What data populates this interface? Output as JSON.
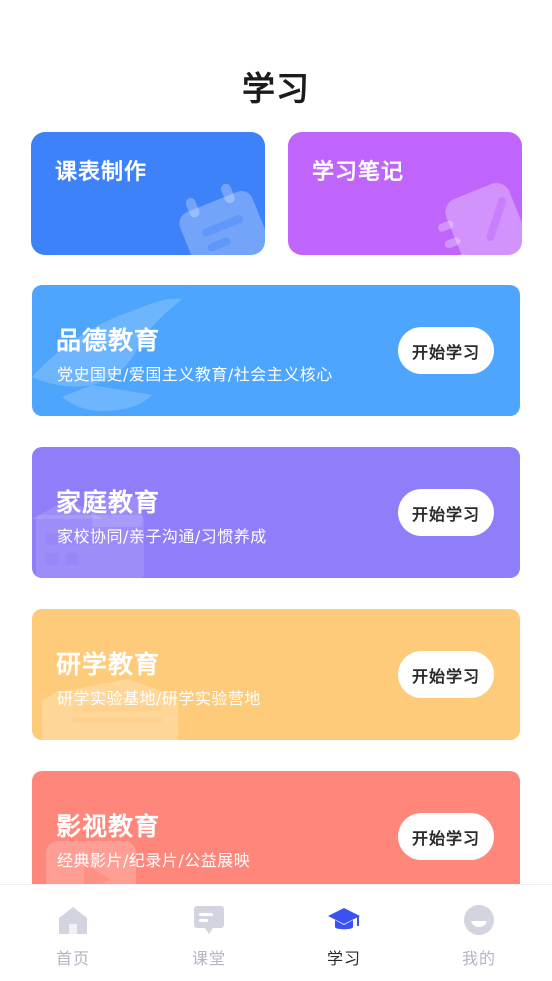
{
  "header": {
    "title": "学习"
  },
  "top_cards": [
    {
      "label": "课表制作",
      "icon": "calendar-icon",
      "color": "#3d82f8"
    },
    {
      "label": "学习笔记",
      "icon": "notebook-icon",
      "color": "#c065fb"
    }
  ],
  "courses": [
    {
      "title": "品德教育",
      "subtitle": "党史国史/爱国主义教育/社会主义核心",
      "button": "开始学习",
      "color": "#4ea5fd",
      "icon": "dove-icon"
    },
    {
      "title": "家庭教育",
      "subtitle": "家校协同/亲子沟通/习惯养成",
      "button": "开始学习",
      "color": "#8f7ef9",
      "icon": "building-icon"
    },
    {
      "title": "研学教育",
      "subtitle": "研学实验基地/研学实验营地",
      "button": "开始学习",
      "color": "#fecb7b",
      "icon": "book-icon"
    },
    {
      "title": "影视教育",
      "subtitle": "经典影片/纪录片/公益展映",
      "button": "开始学习",
      "color": "#fe867a",
      "icon": "play-icon"
    }
  ],
  "tabbar": {
    "items": [
      {
        "label": "首页",
        "icon": "home-icon",
        "active": false
      },
      {
        "label": "课堂",
        "icon": "classroom-icon",
        "active": false
      },
      {
        "label": "学习",
        "icon": "graduation-cap-icon",
        "active": true
      },
      {
        "label": "我的",
        "icon": "profile-icon",
        "active": false
      }
    ],
    "active_color": "#3a52f2",
    "inactive_color": "#d4d4e0"
  }
}
